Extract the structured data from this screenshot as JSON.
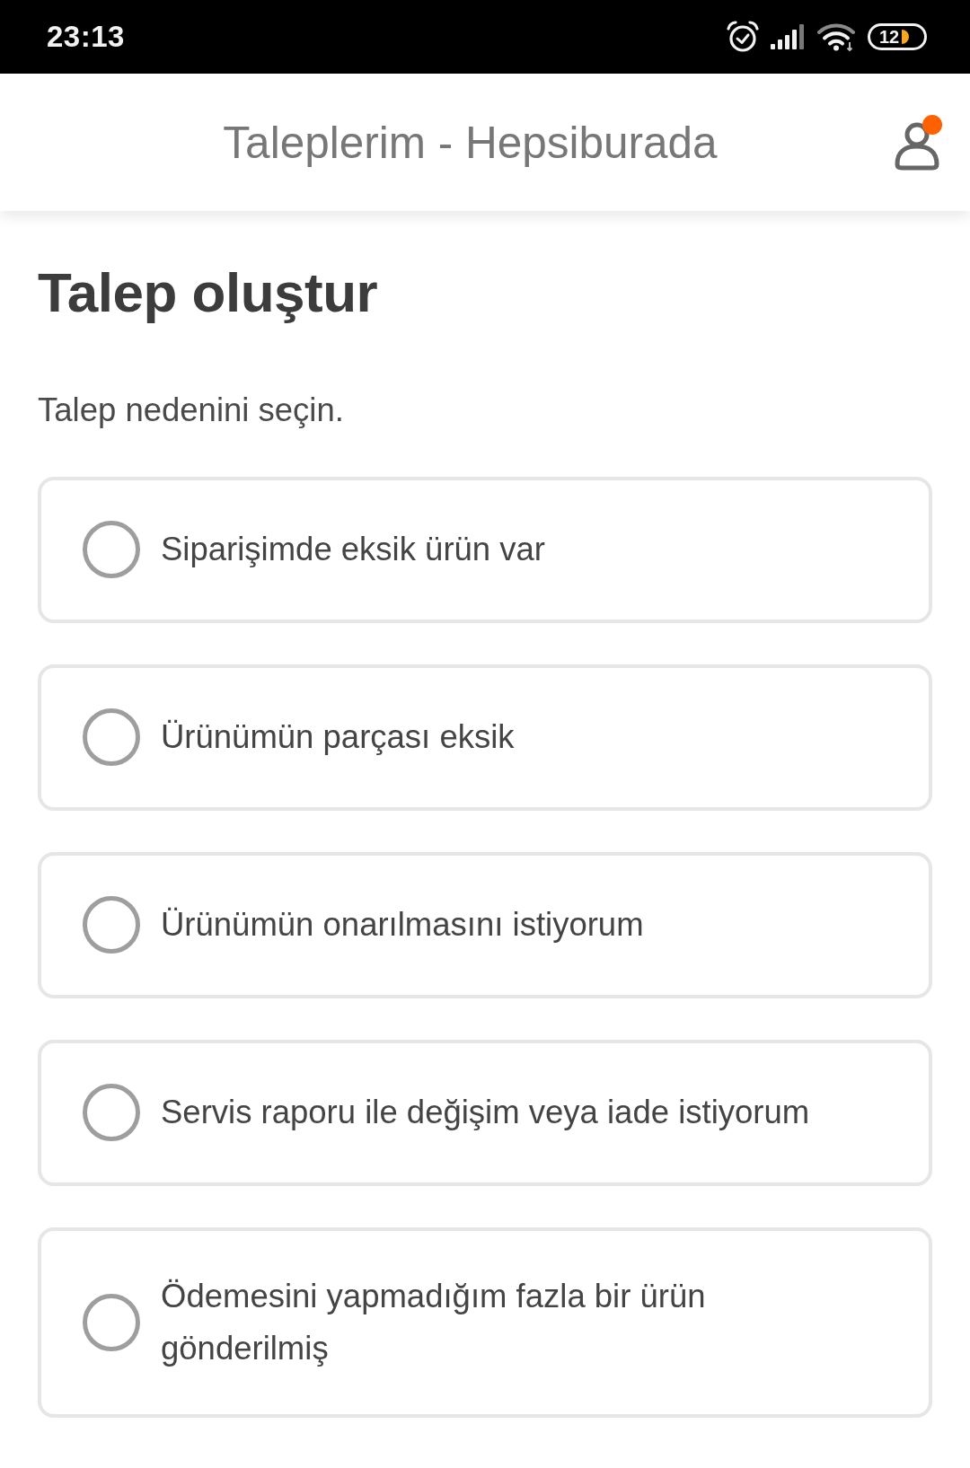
{
  "status_bar": {
    "time": "23:13",
    "battery": "12"
  },
  "header": {
    "title": "Taleplerim - Hepsiburada",
    "has_notification": true
  },
  "page": {
    "title": "Talep oluştur",
    "subtitle": "Talep nedenini seçin."
  },
  "options": [
    {
      "label": "Siparişimde eksik ürün var",
      "selected": false
    },
    {
      "label": "Ürünümün parçası eksik",
      "selected": false
    },
    {
      "label": "Ürünümün onarılmasını istiyorum",
      "selected": false
    },
    {
      "label": "Servis raporu ile değişim veya iade istiyorum",
      "selected": false
    },
    {
      "label": "Ödemesini yapmadığım fazla bir ürün gönderilmiş",
      "selected": false
    }
  ]
}
